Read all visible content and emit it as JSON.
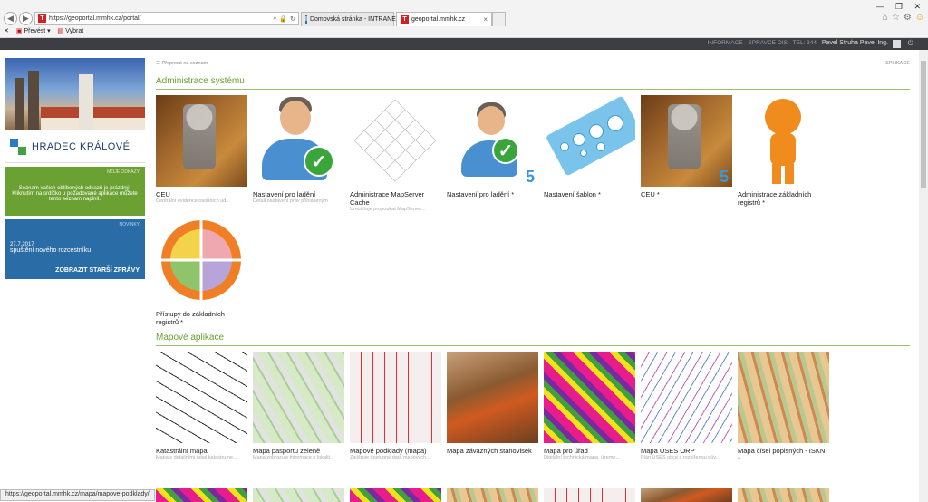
{
  "browser": {
    "url": "https://geoportal.mmhk.cz/portal/",
    "tabs": [
      {
        "label": "Domovská stránka - INTRANET"
      },
      {
        "label": "geoportal.mmhk.cz"
      }
    ],
    "favorites": [
      {
        "label": "Převést"
      },
      {
        "label": "Vybrat"
      }
    ],
    "status_url": "https://geoportal.mmhk.cz/mapa/mapove-podklady/"
  },
  "topbar": {
    "info": "INFORMACE - SPRAVCE OIS - TEL: 344",
    "user": "Pavel Struha Pavel Ing."
  },
  "sidebar": {
    "city_name": "HRADEC KRÁLOVÉ",
    "favorites_box": {
      "tag": "MOJE ODKAZY",
      "text": "Seznam vašich oblíbených odkazů je prázdný. Kliknutím na srdíčko u požadované aplikace můžete tento seznam naplnit."
    },
    "news_box": {
      "tag": "NOVINKY",
      "date": "27.7.2017",
      "text": "spuštění nového rozcestníku",
      "button": "ZOBRAZIT STARŠÍ ZPRÁVY"
    }
  },
  "main": {
    "breadcrumb": "Přepnout na seznam",
    "right_link": "SPLIKACE",
    "sections": [
      {
        "title": "Administrace systému",
        "tiles": [
          {
            "label": "CEU",
            "sub": "Centrální evidence osobních ud..."
          },
          {
            "label": "Nastavení pro ladění",
            "sub": "Detail nastavení práv přihlášeným"
          },
          {
            "label": "Administrace MapServer Cache",
            "sub": "Umožňuje propoukat MapServer..."
          },
          {
            "label": "Nastavení pro ladění *",
            "sub": ""
          },
          {
            "label": "Nastavení šablon *",
            "sub": ""
          },
          {
            "label": "CEU *",
            "sub": ""
          },
          {
            "label": "Administrace základních registrů *",
            "sub": ""
          },
          {
            "label": "Přístupy do základních registrů *",
            "sub": ""
          }
        ]
      },
      {
        "title": "Mapové aplikace",
        "tiles": [
          {
            "label": "Katastrální mapa",
            "sub": "Mapa s detailními údaji katastru ne..."
          },
          {
            "label": "Mapa pasportu zeleně",
            "sub": "Mapa zobrazuje informace o lokalit..."
          },
          {
            "label": "Mapové podklady (mapa)",
            "sub": "Zajišťuje dostupné data mapových..."
          },
          {
            "label": "Mapa závazných stanovisek",
            "sub": ""
          },
          {
            "label": "Mapa pro úřad",
            "sub": "Digitální technická mapa, územn..."
          },
          {
            "label": "Mapa ÚSES ORP",
            "sub": "Plán ÚSES obce s rozšířenou pův..."
          },
          {
            "label": "Mapa čísel popisných - ISKN *",
            "sub": ""
          }
        ]
      }
    ]
  },
  "icons": [
    "back-icon",
    "forward-icon",
    "home-icon",
    "star-icon",
    "gear-icon",
    "smiley-icon",
    "search-icon",
    "lock-icon",
    "refresh-icon",
    "logout-icon"
  ]
}
